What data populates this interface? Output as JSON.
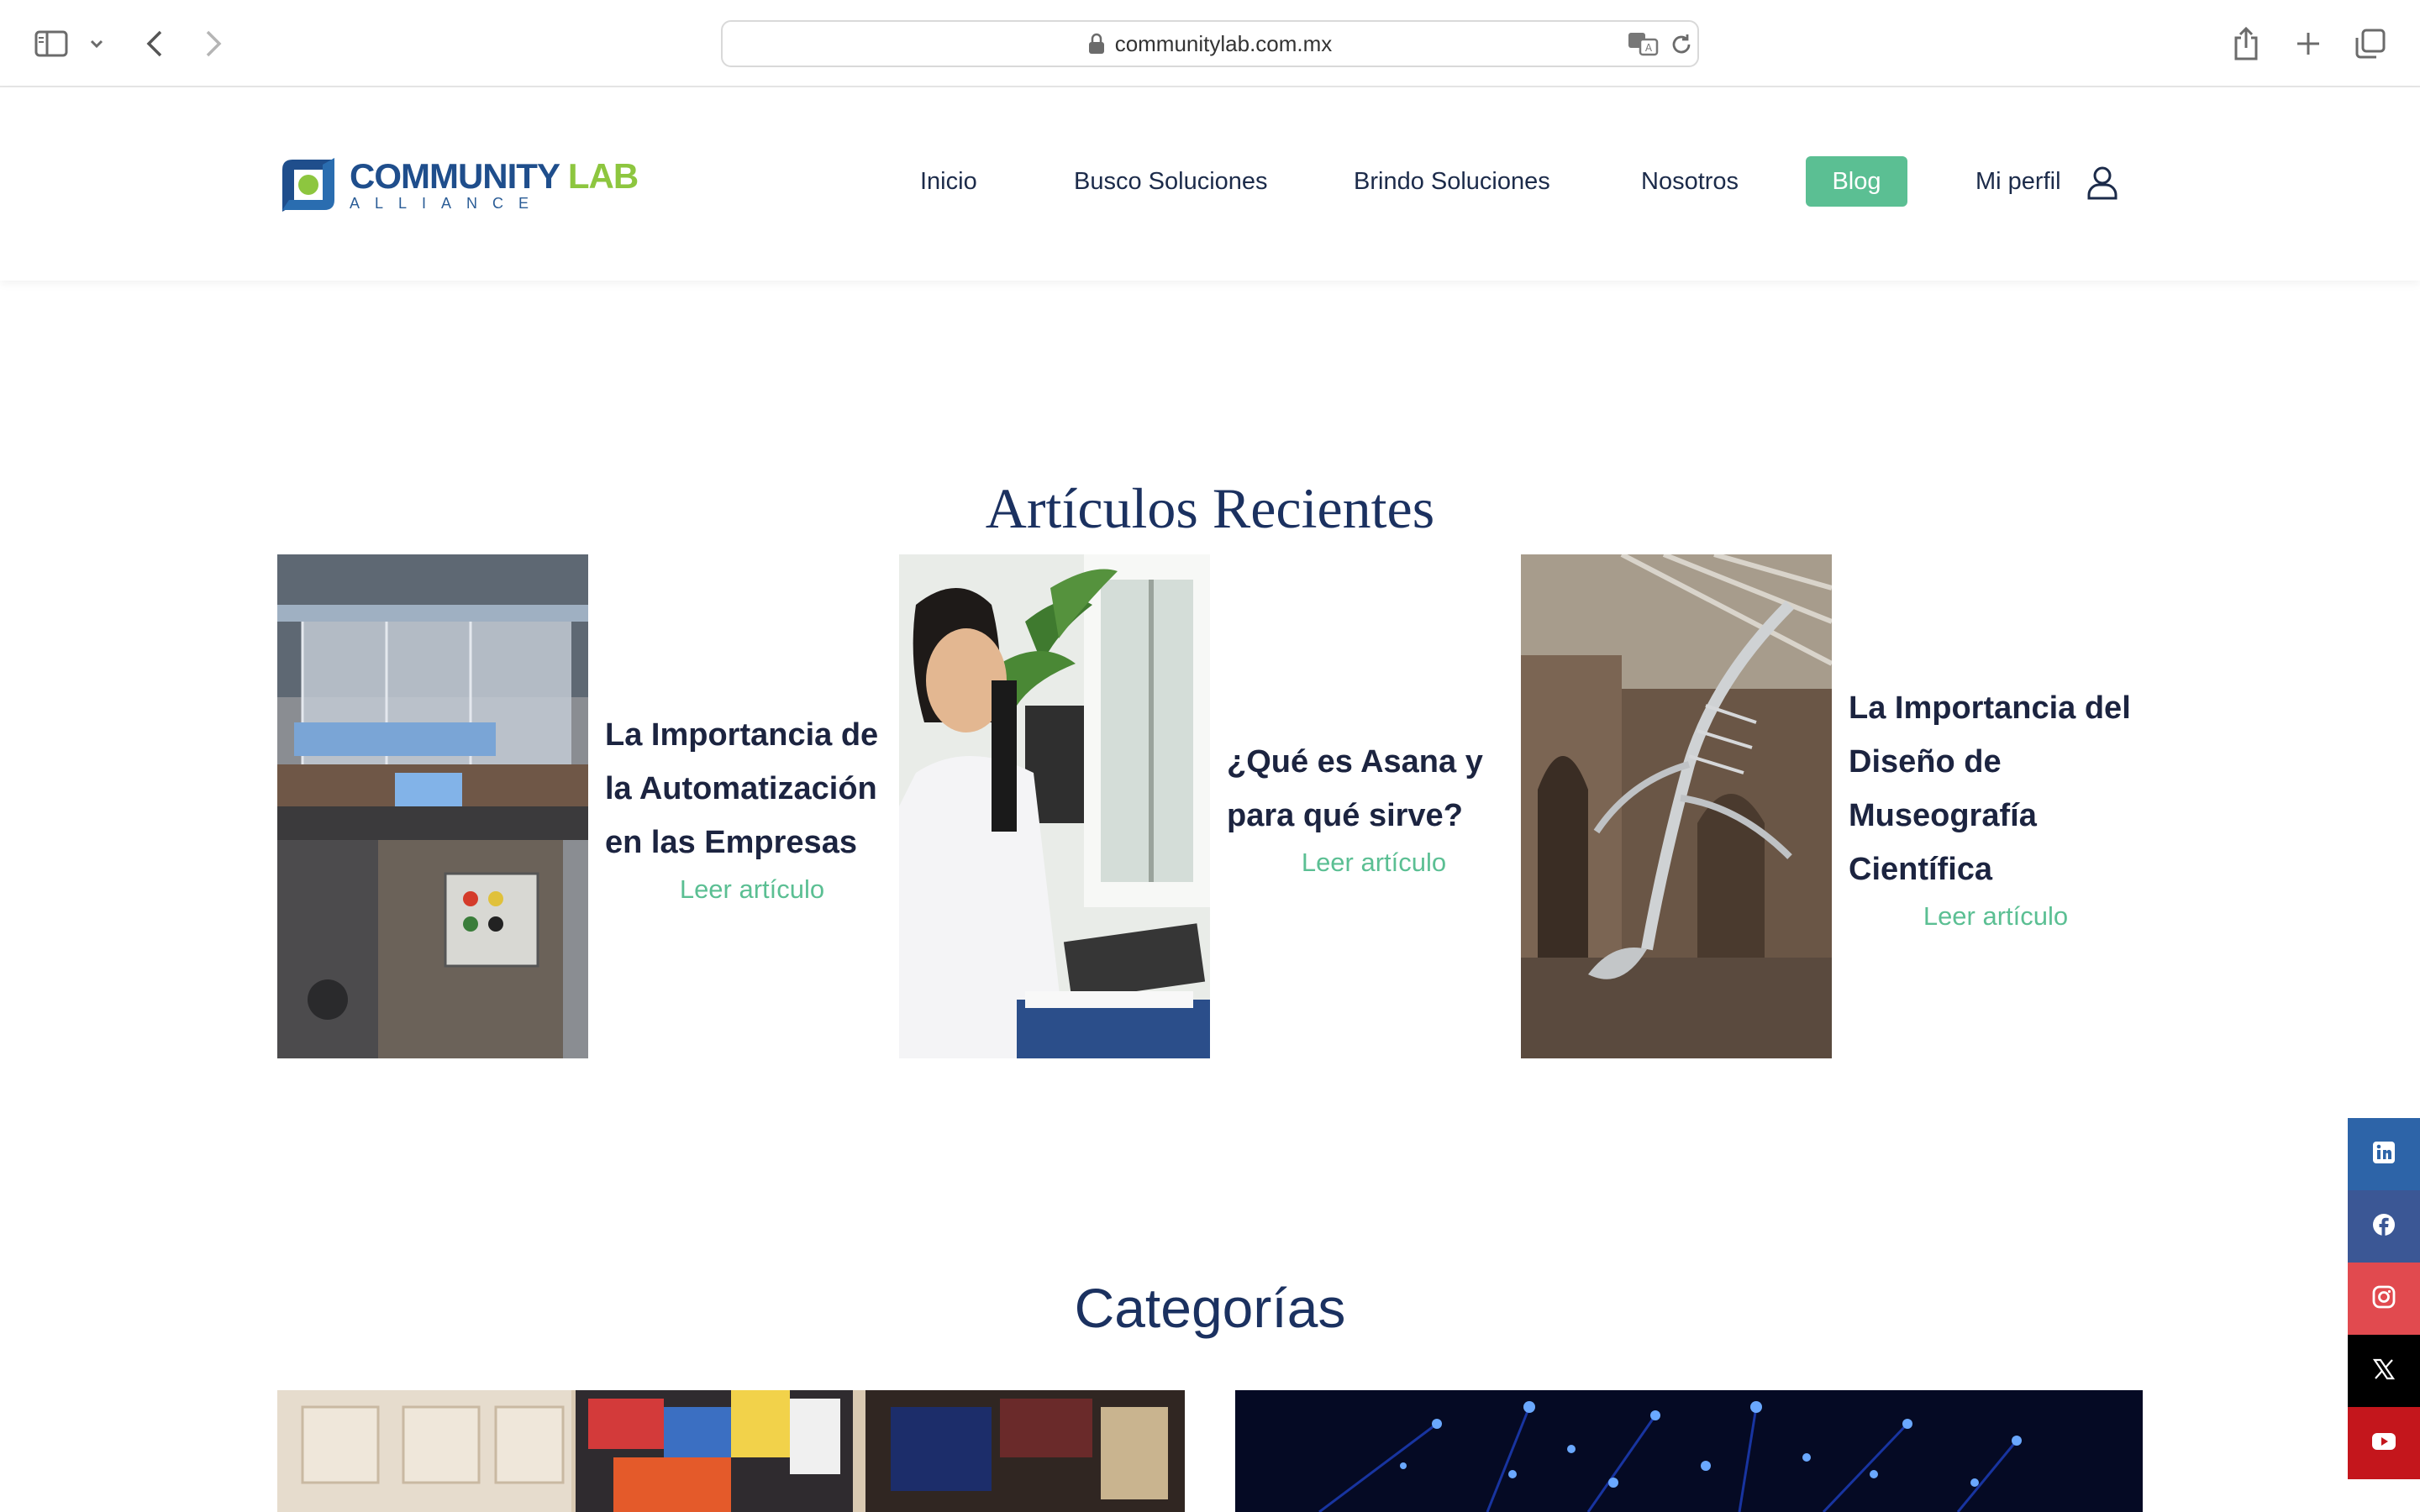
{
  "browser": {
    "url": "communitylab.com.mx"
  },
  "logo": {
    "word1": "COMMUNITY",
    "word2": "LAB",
    "sub": "ALLIANCE"
  },
  "nav": {
    "items": [
      {
        "label": "Inicio"
      },
      {
        "label": "Busco Soluciones"
      },
      {
        "label": "Brindo Soluciones"
      },
      {
        "label": "Nosotros"
      },
      {
        "label": "Blog",
        "active": true
      },
      {
        "label": "Mi perfil"
      }
    ]
  },
  "recent": {
    "title": "Artículos Recientes",
    "articles": [
      {
        "title_lines": [
          "La Importancia de",
          "la Automatización",
          "en las Empresas"
        ],
        "link": "Leer artículo"
      },
      {
        "title_lines": [
          "¿Qué es Asana y",
          "para qué sirve?"
        ],
        "link": "Leer artículo"
      },
      {
        "title_lines": [
          "La Importancia del",
          "Diseño de",
          "Museografía",
          "Científica"
        ],
        "link": "Leer artículo"
      }
    ]
  },
  "categories": {
    "title": "Categorías"
  },
  "colors": {
    "accent_green": "#5bbf93",
    "navy": "#1b3160",
    "linkedin": "#2d64a8",
    "facebook": "#3b5795",
    "instagram": "#e14a4f",
    "x": "#000000",
    "youtube": "#c4161c"
  },
  "social": [
    {
      "icon": "linkedin-icon"
    },
    {
      "icon": "facebook-icon"
    },
    {
      "icon": "instagram-icon"
    },
    {
      "icon": "x-icon"
    },
    {
      "icon": "youtube-icon"
    }
  ]
}
